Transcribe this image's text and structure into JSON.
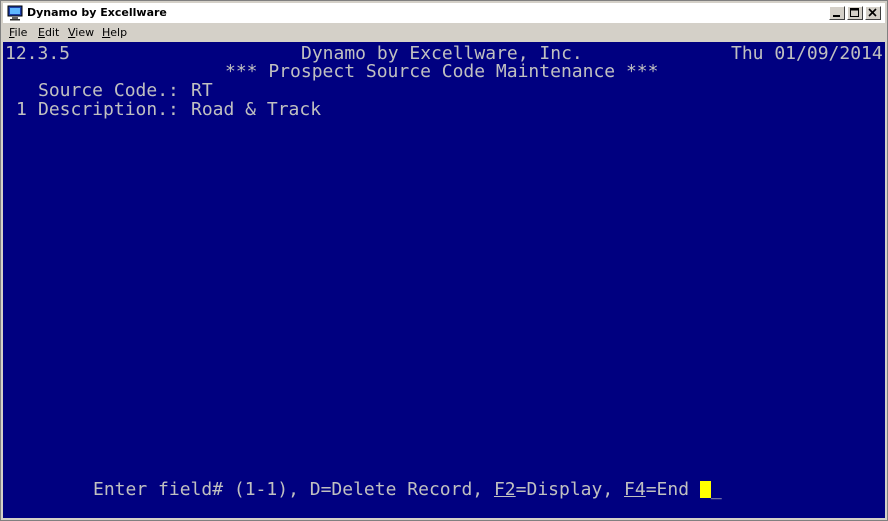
{
  "window": {
    "title": "Dynamo by Excellware",
    "buttons": [
      "minimize",
      "maximize",
      "close"
    ]
  },
  "menu": {
    "items": [
      {
        "label": "File",
        "mnemonic": "F",
        "rest": "ile"
      },
      {
        "label": "Edit",
        "mnemonic": "E",
        "rest": "dit"
      },
      {
        "label": "View",
        "mnemonic": "V",
        "rest": "iew"
      },
      {
        "label": "Help",
        "mnemonic": "H",
        "rest": "elp"
      }
    ]
  },
  "screen": {
    "version": "12.3.5",
    "company": "Dynamo by Excellware, Inc.",
    "date": "Thu 01/09/2014",
    "heading": "*** Prospect Source Code Maintenance ***",
    "source_code_label": "Source Code.:",
    "source_code_value": "RT",
    "field_number": "1",
    "description_label": "Description.:",
    "description_value": "Road & Track",
    "prompt_text": "Enter field# (1-1), D=Delete Record, ",
    "f2_key": "F2",
    "f2_text": "=Display, ",
    "f4_key": "F4",
    "f4_text": "=End ",
    "cursor_tail": "_"
  },
  "colors": {
    "screen_bg": "#000080",
    "screen_text": "#c0c0c0",
    "cursor": "#ffff00"
  }
}
